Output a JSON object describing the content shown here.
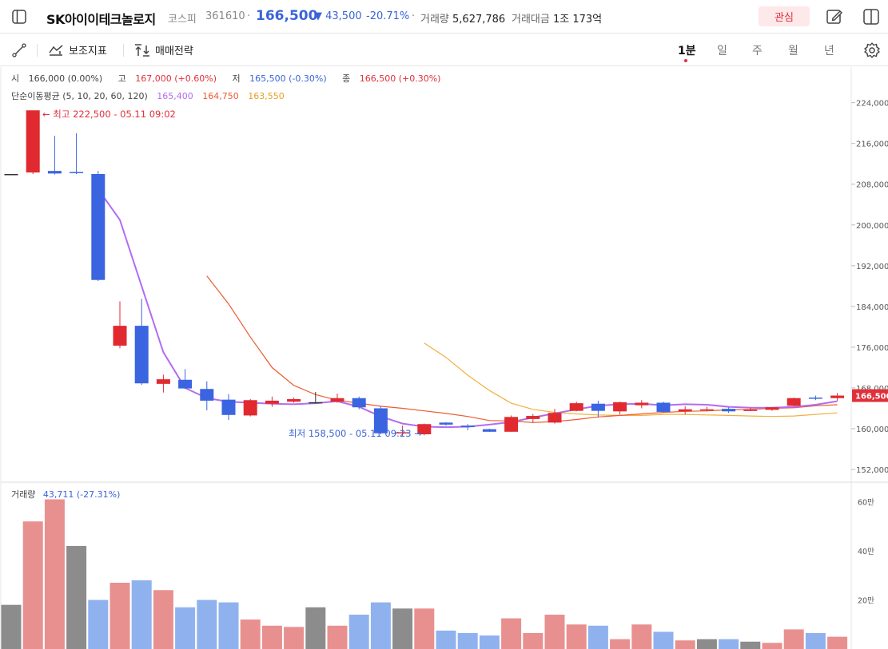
{
  "header": {
    "title": "SK아이이테크놀로지",
    "market": "코스피",
    "code": "361610",
    "price": "166,500",
    "change": "▼ 43,500",
    "change_pct": "-20.71%",
    "volume_label": "거래량",
    "volume_value": "5,627,786",
    "amount_label": "거래대금",
    "amount_value": "1조 173억",
    "watch_label": "관심"
  },
  "toolbar": {
    "indicator_label": "보조지표",
    "strategy_label": "매매전략",
    "periods": [
      "1분",
      "일",
      "주",
      "월",
      "년"
    ]
  },
  "legend": {
    "open_label": "시",
    "open_value": "166,000 (0.00%)",
    "high_label": "고",
    "high_value": "167,000 (+0.60%)",
    "low_label": "저",
    "low_value": "165,500 (-0.30%)",
    "close_label": "종",
    "close_value": "166,500 (+0.30%)",
    "ma_label": "단순이동평균 (5, 10, 20, 60, 120)",
    "ma_values": [
      "165,400",
      "164,750",
      "163,550"
    ],
    "volume_label": "거래량",
    "volume_value": "43,711 (-27.31%)"
  },
  "annotations": {
    "max_label": "← 최고 222,500 - 05.11 09:02",
    "min_label": "최저 158,500 - 05.11 09:23 →"
  },
  "colors": {
    "up": "#e02a2f",
    "down": "#3a64e0",
    "vol_up": "#e8908f",
    "vol_down": "#8fb2ef",
    "vol_flat": "#8c8c8c",
    "ma5": "#b36cf0",
    "ma10": "#ee5a30",
    "ma20": "#f0b040",
    "current_price_bg": "#e0303a"
  },
  "chart_data": {
    "type": "candlestick",
    "price_axis": {
      "ticks": [
        152000,
        160000,
        168000,
        176000,
        184000,
        192000,
        200000,
        208000,
        216000,
        224000
      ],
      "tick_labels": [
        "152,000",
        "160,000",
        "168,000",
        "176,000",
        "184,000",
        "192,000",
        "200,000",
        "208,000",
        "216,000",
        "224,000"
      ],
      "range": [
        149500,
        231000
      ],
      "current_price": 166500,
      "current_price_label": "166,500"
    },
    "volume_axis": {
      "ticks": [
        20,
        40,
        60
      ],
      "tick_labels": [
        "20만",
        "40만",
        "60만"
      ],
      "range": [
        0,
        68
      ],
      "unit": "만"
    },
    "candles": [
      {
        "o": 210000,
        "h": 210000,
        "l": 210000,
        "c": 210000
      },
      {
        "o": 210300,
        "h": 222500,
        "l": 210000,
        "c": 222500
      },
      {
        "o": 210600,
        "h": 217500,
        "l": 209900,
        "c": 210100
      },
      {
        "o": 210400,
        "h": 218000,
        "l": 210000,
        "c": 210300
      },
      {
        "o": 210000,
        "h": 210600,
        "l": 189000,
        "c": 189200
      },
      {
        "o": 176300,
        "h": 185000,
        "l": 175800,
        "c": 180200
      },
      {
        "o": 180200,
        "h": 185500,
        "l": 168600,
        "c": 168900
      },
      {
        "o": 168800,
        "h": 170600,
        "l": 167100,
        "c": 169700
      },
      {
        "o": 169600,
        "h": 171700,
        "l": 167800,
        "c": 167900
      },
      {
        "o": 167800,
        "h": 169300,
        "l": 163600,
        "c": 165500
      },
      {
        "o": 165700,
        "h": 166800,
        "l": 161700,
        "c": 162700
      },
      {
        "o": 162600,
        "h": 165800,
        "l": 162400,
        "c": 165600
      },
      {
        "o": 164900,
        "h": 166300,
        "l": 164300,
        "c": 165500
      },
      {
        "o": 165300,
        "h": 166100,
        "l": 165100,
        "c": 165800
      },
      {
        "o": 165200,
        "h": 167200,
        "l": 165000,
        "c": 165200
      },
      {
        "o": 165300,
        "h": 166900,
        "l": 165100,
        "c": 166000
      },
      {
        "o": 166000,
        "h": 166300,
        "l": 163800,
        "c": 164200
      },
      {
        "o": 164000,
        "h": 164400,
        "l": 158900,
        "c": 159100
      },
      {
        "o": 159200,
        "h": 160600,
        "l": 158500,
        "c": 159300
      },
      {
        "o": 158900,
        "h": 161000,
        "l": 158700,
        "c": 160900
      },
      {
        "o": 161200,
        "h": 161300,
        "l": 160600,
        "c": 160800
      },
      {
        "o": 160600,
        "h": 160900,
        "l": 159700,
        "c": 160300
      },
      {
        "o": 159900,
        "h": 160000,
        "l": 159400,
        "c": 159400
      },
      {
        "o": 159400,
        "h": 162600,
        "l": 159400,
        "c": 162300
      },
      {
        "o": 161900,
        "h": 162900,
        "l": 161200,
        "c": 162500
      },
      {
        "o": 161200,
        "h": 163900,
        "l": 161000,
        "c": 163100
      },
      {
        "o": 163500,
        "h": 165300,
        "l": 163400,
        "c": 165000
      },
      {
        "o": 164900,
        "h": 165500,
        "l": 162200,
        "c": 163500
      },
      {
        "o": 163400,
        "h": 165300,
        "l": 162800,
        "c": 165200
      },
      {
        "o": 164600,
        "h": 165600,
        "l": 164000,
        "c": 165100
      },
      {
        "o": 165100,
        "h": 165300,
        "l": 163200,
        "c": 163300
      },
      {
        "o": 163400,
        "h": 164400,
        "l": 162800,
        "c": 163800
      },
      {
        "o": 163700,
        "h": 164300,
        "l": 163400,
        "c": 163800
      },
      {
        "o": 163900,
        "h": 164200,
        "l": 163100,
        "c": 163400
      },
      {
        "o": 163600,
        "h": 164100,
        "l": 163500,
        "c": 163700
      },
      {
        "o": 163700,
        "h": 164200,
        "l": 163500,
        "c": 164200
      },
      {
        "o": 164500,
        "h": 166100,
        "l": 164400,
        "c": 166000
      },
      {
        "o": 166100,
        "h": 166500,
        "l": 165600,
        "c": 166000
      },
      {
        "o": 166000,
        "h": 167000,
        "l": 165500,
        "c": 166500
      }
    ],
    "volumes": [
      18,
      52,
      61,
      42,
      20,
      27,
      28,
      24,
      17,
      20,
      19,
      12,
      9.5,
      9,
      17,
      9.5,
      14,
      19,
      16.5,
      16.5,
      7.5,
      6.5,
      5.5,
      12.5,
      6.5,
      14,
      10,
      9.5,
      4,
      10,
      7,
      3.5,
      4,
      4,
      3,
      2.5,
      8,
      6.5,
      5
    ],
    "volume_colors": [
      "flat",
      "up",
      "up",
      "flat",
      "down",
      "up",
      "down",
      "up",
      "down",
      "down",
      "down",
      "up",
      "up",
      "up",
      "flat",
      "up",
      "down",
      "down",
      "flat",
      "up",
      "down",
      "down",
      "down",
      "up",
      "up",
      "up",
      "up",
      "down",
      "up",
      "up",
      "down",
      "up",
      "flat",
      "down",
      "flat",
      "up",
      "up",
      "down",
      "up"
    ],
    "ma5": [
      null,
      null,
      null,
      null,
      207000,
      201000,
      188000,
      175000,
      168000,
      166000,
      165300,
      165100,
      164900,
      164800,
      165000,
      165400,
      164300,
      162400,
      161000,
      160400,
      160300,
      160400,
      160800,
      161300,
      162200,
      163000,
      163800,
      164500,
      164800,
      164900,
      164600,
      164800,
      164700,
      164300,
      164100,
      164100,
      164300,
      164700,
      165400
    ],
    "ma10": [
      null,
      null,
      null,
      null,
      null,
      null,
      null,
      null,
      null,
      190000,
      184500,
      178000,
      172000,
      168500,
      166700,
      165600,
      165000,
      164400,
      164000,
      163500,
      163000,
      162400,
      161600,
      161500,
      161200,
      161400,
      161800,
      162300,
      162600,
      162900,
      163200,
      163400,
      163500,
      163700,
      163800,
      164000,
      164100,
      164500,
      164700
    ],
    "ma20": [
      null,
      null,
      null,
      null,
      null,
      null,
      null,
      null,
      null,
      null,
      null,
      null,
      null,
      null,
      null,
      null,
      null,
      null,
      null,
      176800,
      174000,
      170500,
      167500,
      165000,
      163800,
      163200,
      162900,
      162700,
      162600,
      162600,
      162800,
      162800,
      162700,
      162600,
      162500,
      162400,
      162500,
      162800,
      163100
    ]
  }
}
